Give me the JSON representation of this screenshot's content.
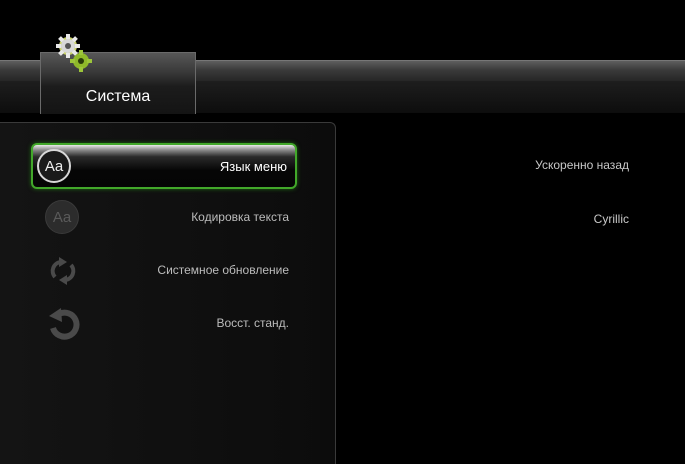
{
  "header": {
    "tab_label": "Система",
    "tab_icon": "gear-icon"
  },
  "menu": {
    "items": [
      {
        "label": "Язык меню",
        "icon": "font-aa-icon",
        "selected": true
      },
      {
        "label": "Кодировка текста",
        "icon": "font-aa-icon",
        "selected": false
      },
      {
        "label": "Системное обновление",
        "icon": "refresh-arrows-icon",
        "selected": false
      },
      {
        "label": "Восст. станд.",
        "icon": "restore-arrow-icon",
        "selected": false
      }
    ]
  },
  "values": {
    "menu_language": "Ускоренно назад",
    "text_encoding": "Cyrillic"
  },
  "colors": {
    "selection_border": "#42a82a",
    "background": "#000000"
  }
}
